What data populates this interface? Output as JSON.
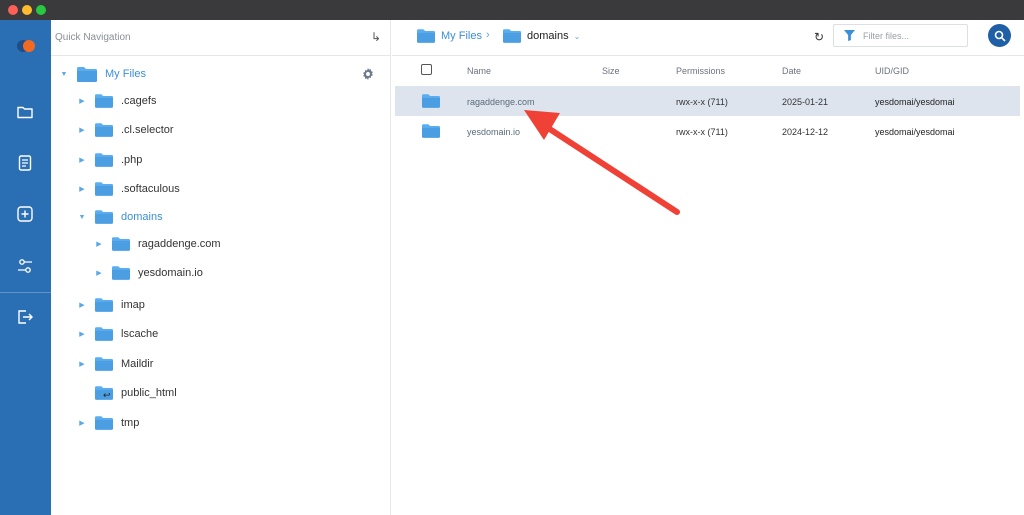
{
  "window": {
    "controls": [
      "close",
      "minimize",
      "maximize"
    ]
  },
  "rail": {
    "items": [
      {
        "name": "folder-icon"
      },
      {
        "name": "notes-icon"
      },
      {
        "name": "add-icon"
      },
      {
        "name": "settings-sliders-icon"
      },
      {
        "name": "logout-icon"
      }
    ]
  },
  "tree": {
    "title": "Quick Navigation",
    "root": "My Files",
    "items": [
      {
        "label": ".cagefs"
      },
      {
        "label": ".cl.selector"
      },
      {
        "label": ".php"
      },
      {
        "label": ".softaculous"
      },
      {
        "label": "domains"
      },
      {
        "label": "ragaddenge.com"
      },
      {
        "label": "yesdomain.io"
      },
      {
        "label": "imap"
      },
      {
        "label": "lscache"
      },
      {
        "label": "Maildir"
      },
      {
        "label": "public_html"
      },
      {
        "label": "tmp"
      }
    ]
  },
  "breadcrumb": {
    "root": "My Files",
    "current": "domains"
  },
  "filter": {
    "placeholder": "Filter files..."
  },
  "table": {
    "headers": {
      "name": "Name",
      "size": "Size",
      "permissions": "Permissions",
      "date": "Date",
      "uid": "UID/GID"
    },
    "rows": [
      {
        "name": "ragaddenge.com",
        "size": "",
        "permissions": "rwx-x-x (711)",
        "date": "2025-01-21",
        "uid": "yesdomai/yesdomai"
      },
      {
        "name": "yesdomain.io",
        "size": "",
        "permissions": "rwx-x-x (711)",
        "date": "2024-12-12",
        "uid": "yesdomai/yesdomai"
      }
    ]
  },
  "colors": {
    "rail": "#2a6fb3",
    "accent": "#3b8fd6",
    "folder": "#5aaef0",
    "arrow": "#ef4135",
    "selected_row": "#dde4ee"
  }
}
